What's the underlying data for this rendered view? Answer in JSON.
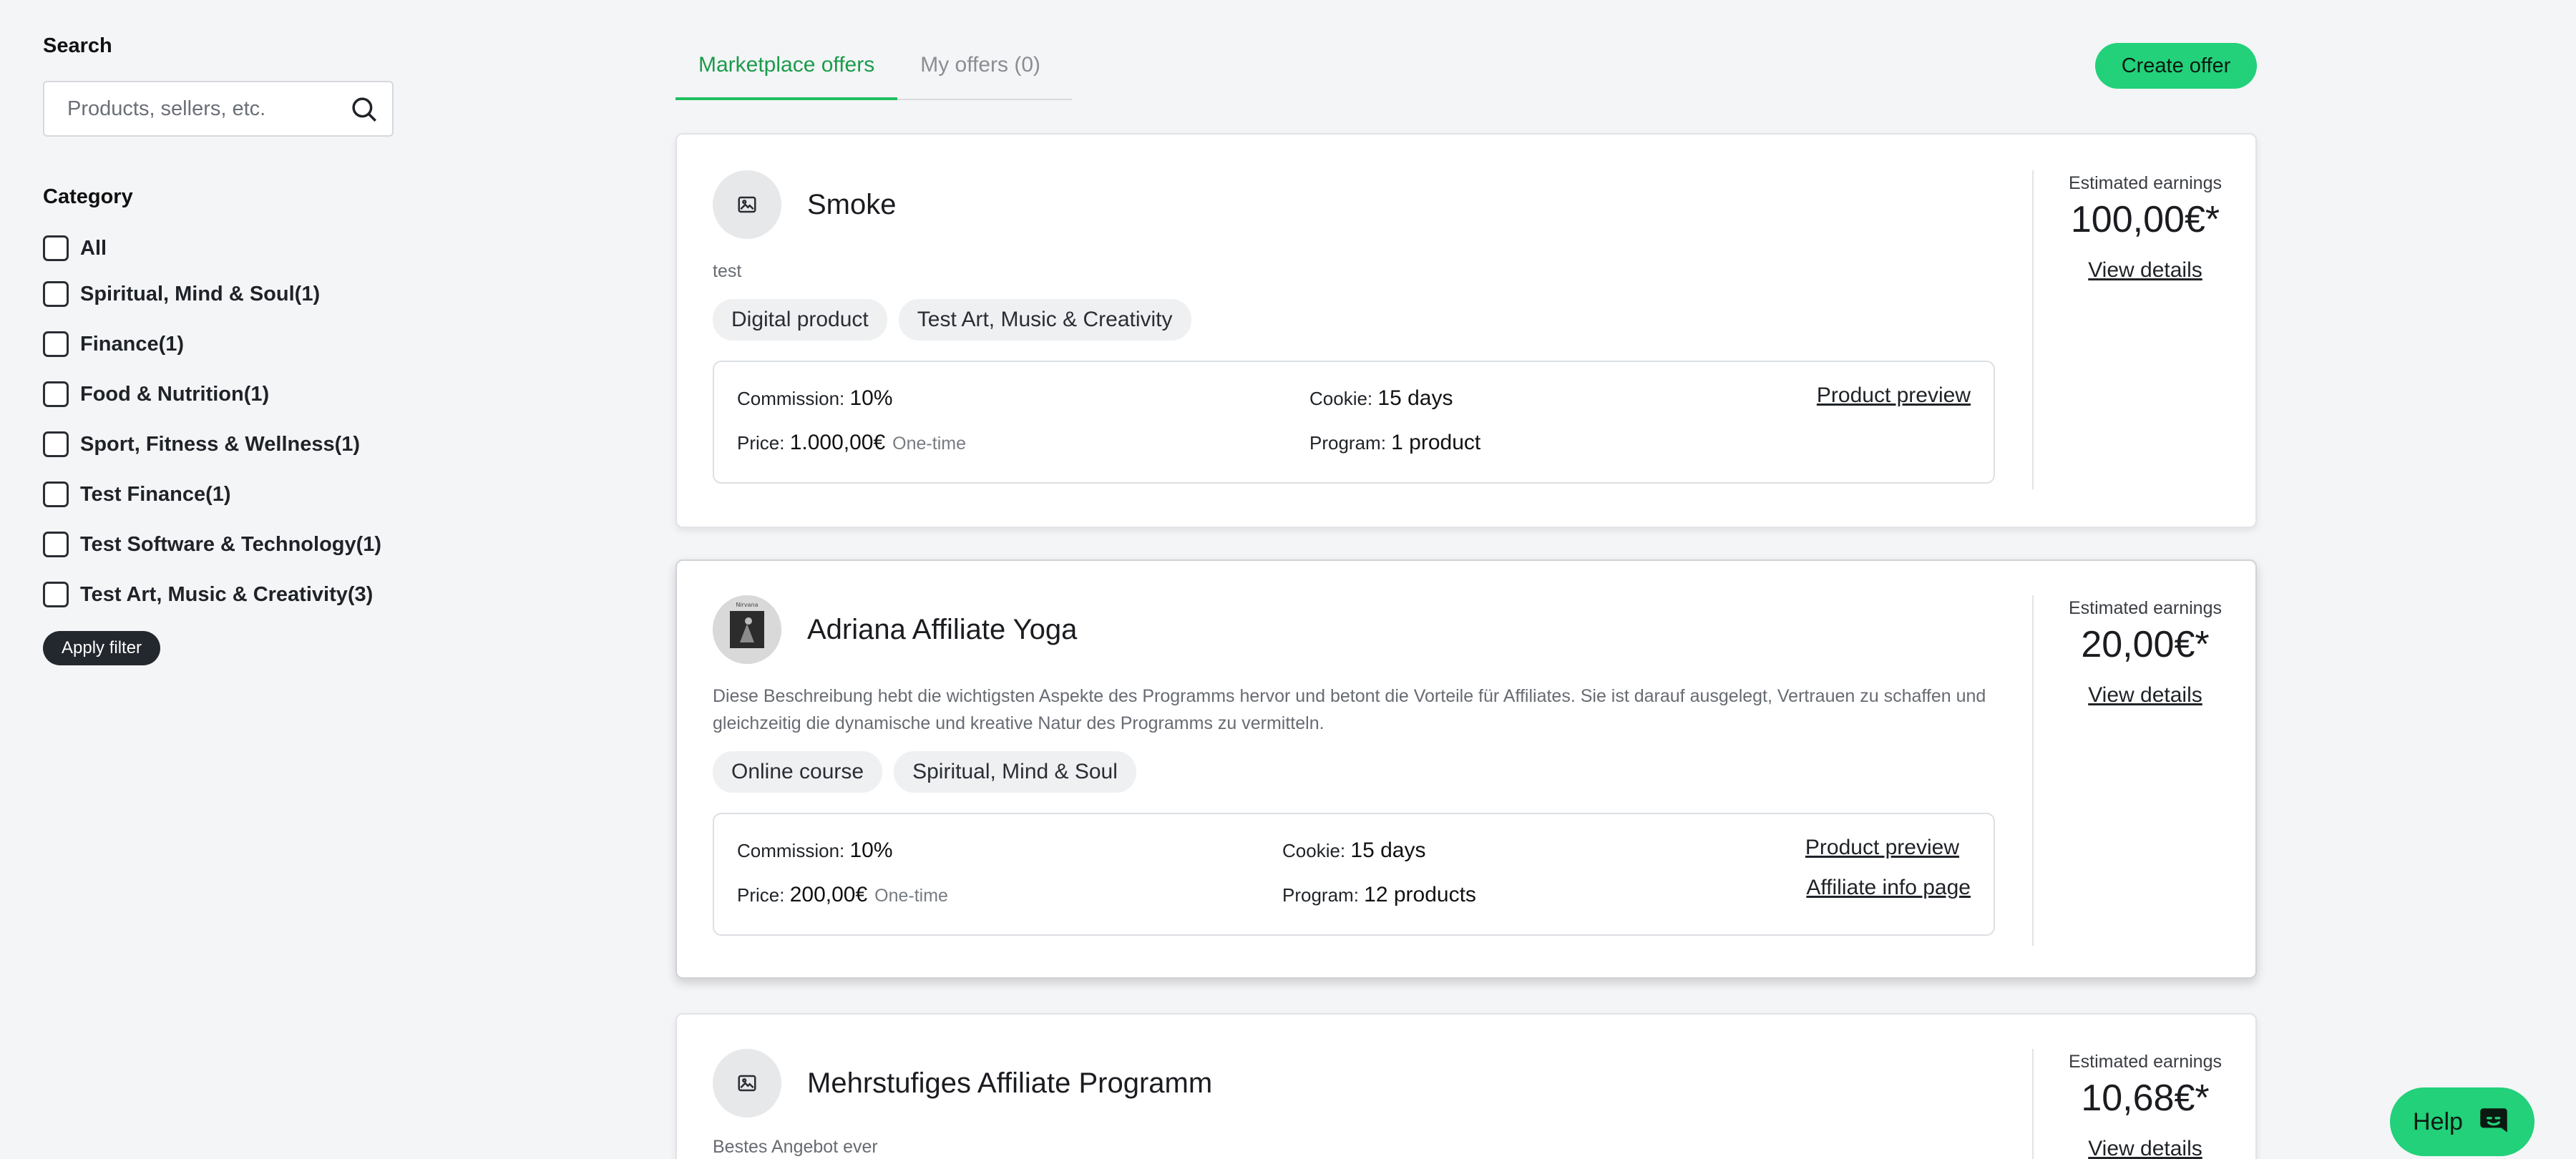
{
  "sidebar": {
    "search_title": "Search",
    "search_placeholder": "Products, sellers, etc.",
    "category_title": "Category",
    "categories": [
      "All",
      "Spiritual, Mind & Soul(1)",
      "Finance(1)",
      "Food & Nutrition(1)",
      "Sport, Fitness & Wellness(1)",
      "Test Finance(1)",
      "Test Software & Technology(1)",
      "Test Art, Music & Creativity(3)"
    ],
    "apply_label": "Apply filter"
  },
  "tabs": [
    "Marketplace offers",
    "My offers (0)"
  ],
  "create_label": "Create offer",
  "labels": {
    "commission": "Commission:",
    "cookie": "Cookie:",
    "price": "Price:",
    "program": "Program:",
    "one_time": "One-time",
    "estimated": "Estimated earnings",
    "view_details": "View details",
    "product_preview": "Product preview",
    "affiliate_info": "Affiliate info page"
  },
  "offers": [
    {
      "title": "Smoke",
      "description": "test",
      "tags": [
        "Digital product",
        "Test Art, Music & Creativity"
      ],
      "commission": "10%",
      "cookie": "15 days",
      "price": "1.000,00€",
      "program": "1 product",
      "earnings": "100,00€*"
    },
    {
      "title": "Adriana Affiliate Yoga",
      "thumb_text": "Nirvana",
      "description": "Diese Beschreibung hebt die wichtigsten Aspekte des Programms hervor und betont die Vorteile für Affiliates. Sie ist darauf ausgelegt, Vertrauen zu schaffen und gleichzeitig die dynamische und kreative Natur des Programms zu vermitteln.",
      "tags": [
        "Online course",
        "Spiritual, Mind & Soul"
      ],
      "commission": "10%",
      "cookie": "15 days",
      "price": "200,00€",
      "program": "12 products",
      "earnings": "20,00€*"
    },
    {
      "title": "Mehrstufiges Affiliate Programm",
      "description": "Bestes Angebot ever",
      "earnings": "10,68€*"
    }
  ],
  "help_label": "Help"
}
